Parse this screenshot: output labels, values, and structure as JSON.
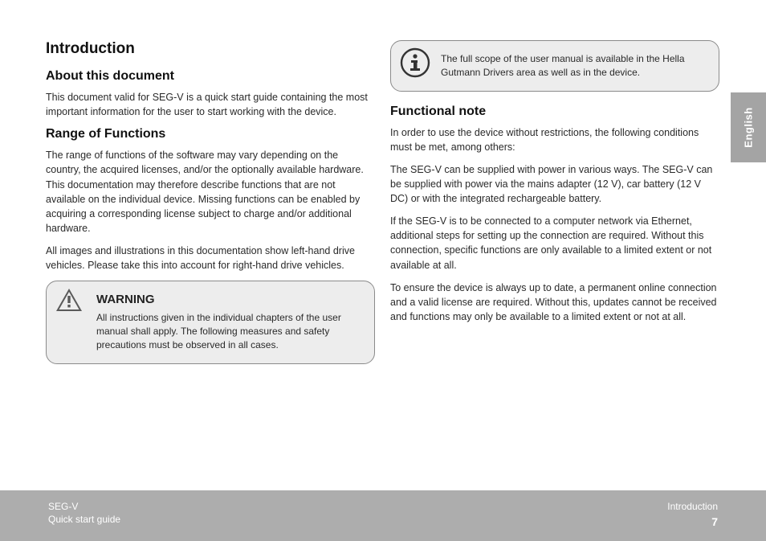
{
  "language_tab": "English",
  "left": {
    "h1": "Introduction",
    "h2_about": "About this document",
    "p_about": "This document valid for SEG-V is a quick start guide containing the most important information for the user to start working with the device.",
    "h2_func": "Range of Functions",
    "p_func1": "The range of functions of the software may vary depending on the country, the acquired licenses, and/or the optionally available hardware. This documentation may therefore describe functions that are not available on the individual device. Missing functions can be enabled by acquiring a corresponding license subject to charge and/or additional hardware.",
    "p_func2": "All images and illustrations in this documentation show left-hand drive vehicles. Please take this into account for right-hand drive vehicles.",
    "warning": {
      "title": "WARNING",
      "text": "All instructions given in the individual chapters of the user manual shall apply. The following measures and safety precautions must be observed in all cases."
    }
  },
  "right": {
    "note": {
      "text": "The full scope of the user manual is available in the Hella Gutmann Drivers area as well as in the device."
    },
    "h2_note": "Functional note",
    "p_note1": "In order to use the device without restrictions, the following conditions must be met, among others:",
    "p_note2": "The SEG-V can be supplied with power in various ways. The SEG-V can be supplied with power via the mains adapter (12 V), car battery (12 V DC) or with the integrated rechargeable battery.",
    "p_note3": "If the SEG-V is to be connected to a computer network via Ethernet, additional steps for setting up the connection are required. Without this connection, specific functions are only available to a limited extent or not available at all.",
    "p_note4": "To ensure the device is always up to date, a permanent online connection and a valid license are required. Without this, updates cannot be received and functions may only be available to a limited extent or not at all."
  },
  "footer": {
    "left_line1": "SEG-V",
    "left_line2": "Quick start guide",
    "right_line1": "Introduction",
    "page": "7"
  }
}
